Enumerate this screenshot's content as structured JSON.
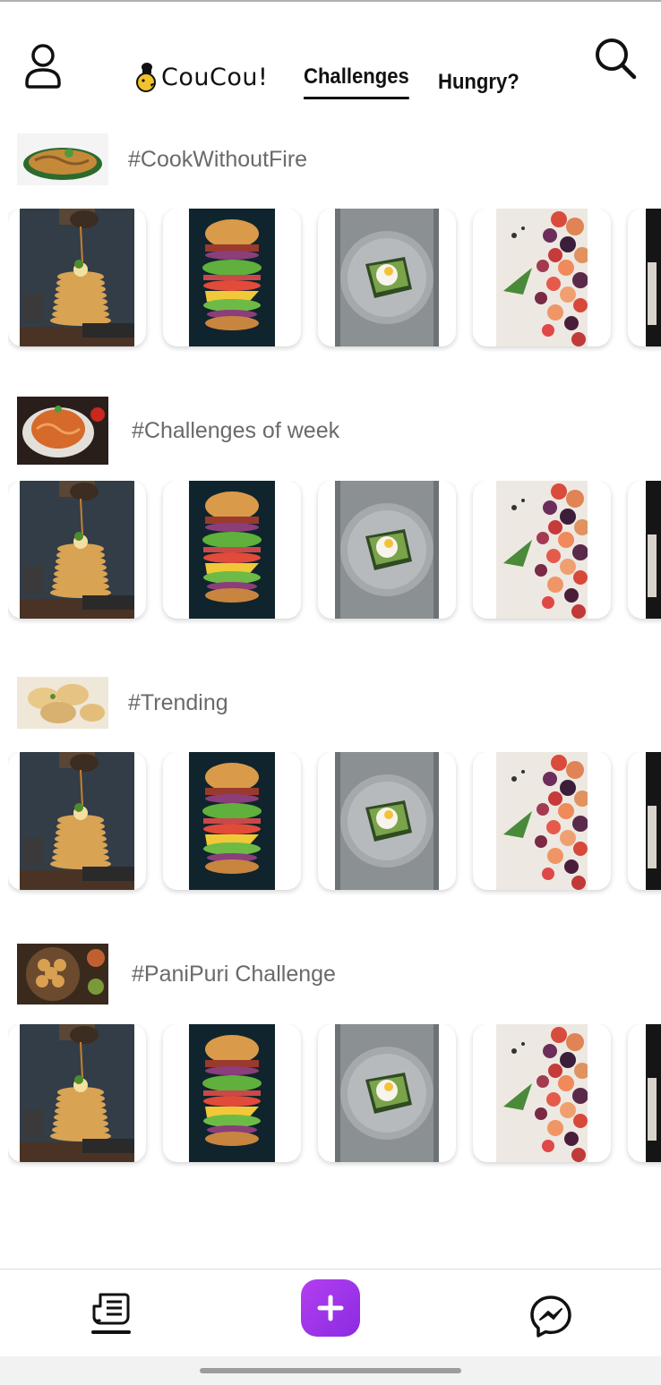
{
  "header": {
    "logo_text": "CouCou!",
    "tabs": [
      {
        "label": "Challenges",
        "active": true
      },
      {
        "label": "Hungry?",
        "active": false
      }
    ],
    "icons": {
      "profile": "user-icon",
      "search": "search-icon"
    }
  },
  "sections": [
    {
      "title": "#CookWithoutFire",
      "thumb": "noodles-thumbnail"
    },
    {
      "title": "#Challenges of week",
      "thumb": "pasta-thumbnail"
    },
    {
      "title": "#Trending",
      "thumb": "dumplings-thumbnail"
    },
    {
      "title": "#PaniPuri Challenge",
      "thumb": "panipuri-thumbnail"
    }
  ],
  "card_images": [
    "pancakes-photo",
    "burger-photo",
    "avocado-toast-photo",
    "fruits-photo",
    "drink-photo"
  ],
  "bottom_nav": {
    "items": [
      {
        "name": "feed",
        "icon": "feed-icon",
        "active": true
      },
      {
        "name": "create",
        "icon": "plus-icon",
        "active": false
      },
      {
        "name": "messages",
        "icon": "messenger-icon",
        "active": false
      }
    ]
  },
  "colors": {
    "accent": "#9b35e8",
    "section_title": "#6a6a6a",
    "text": "#111111"
  }
}
